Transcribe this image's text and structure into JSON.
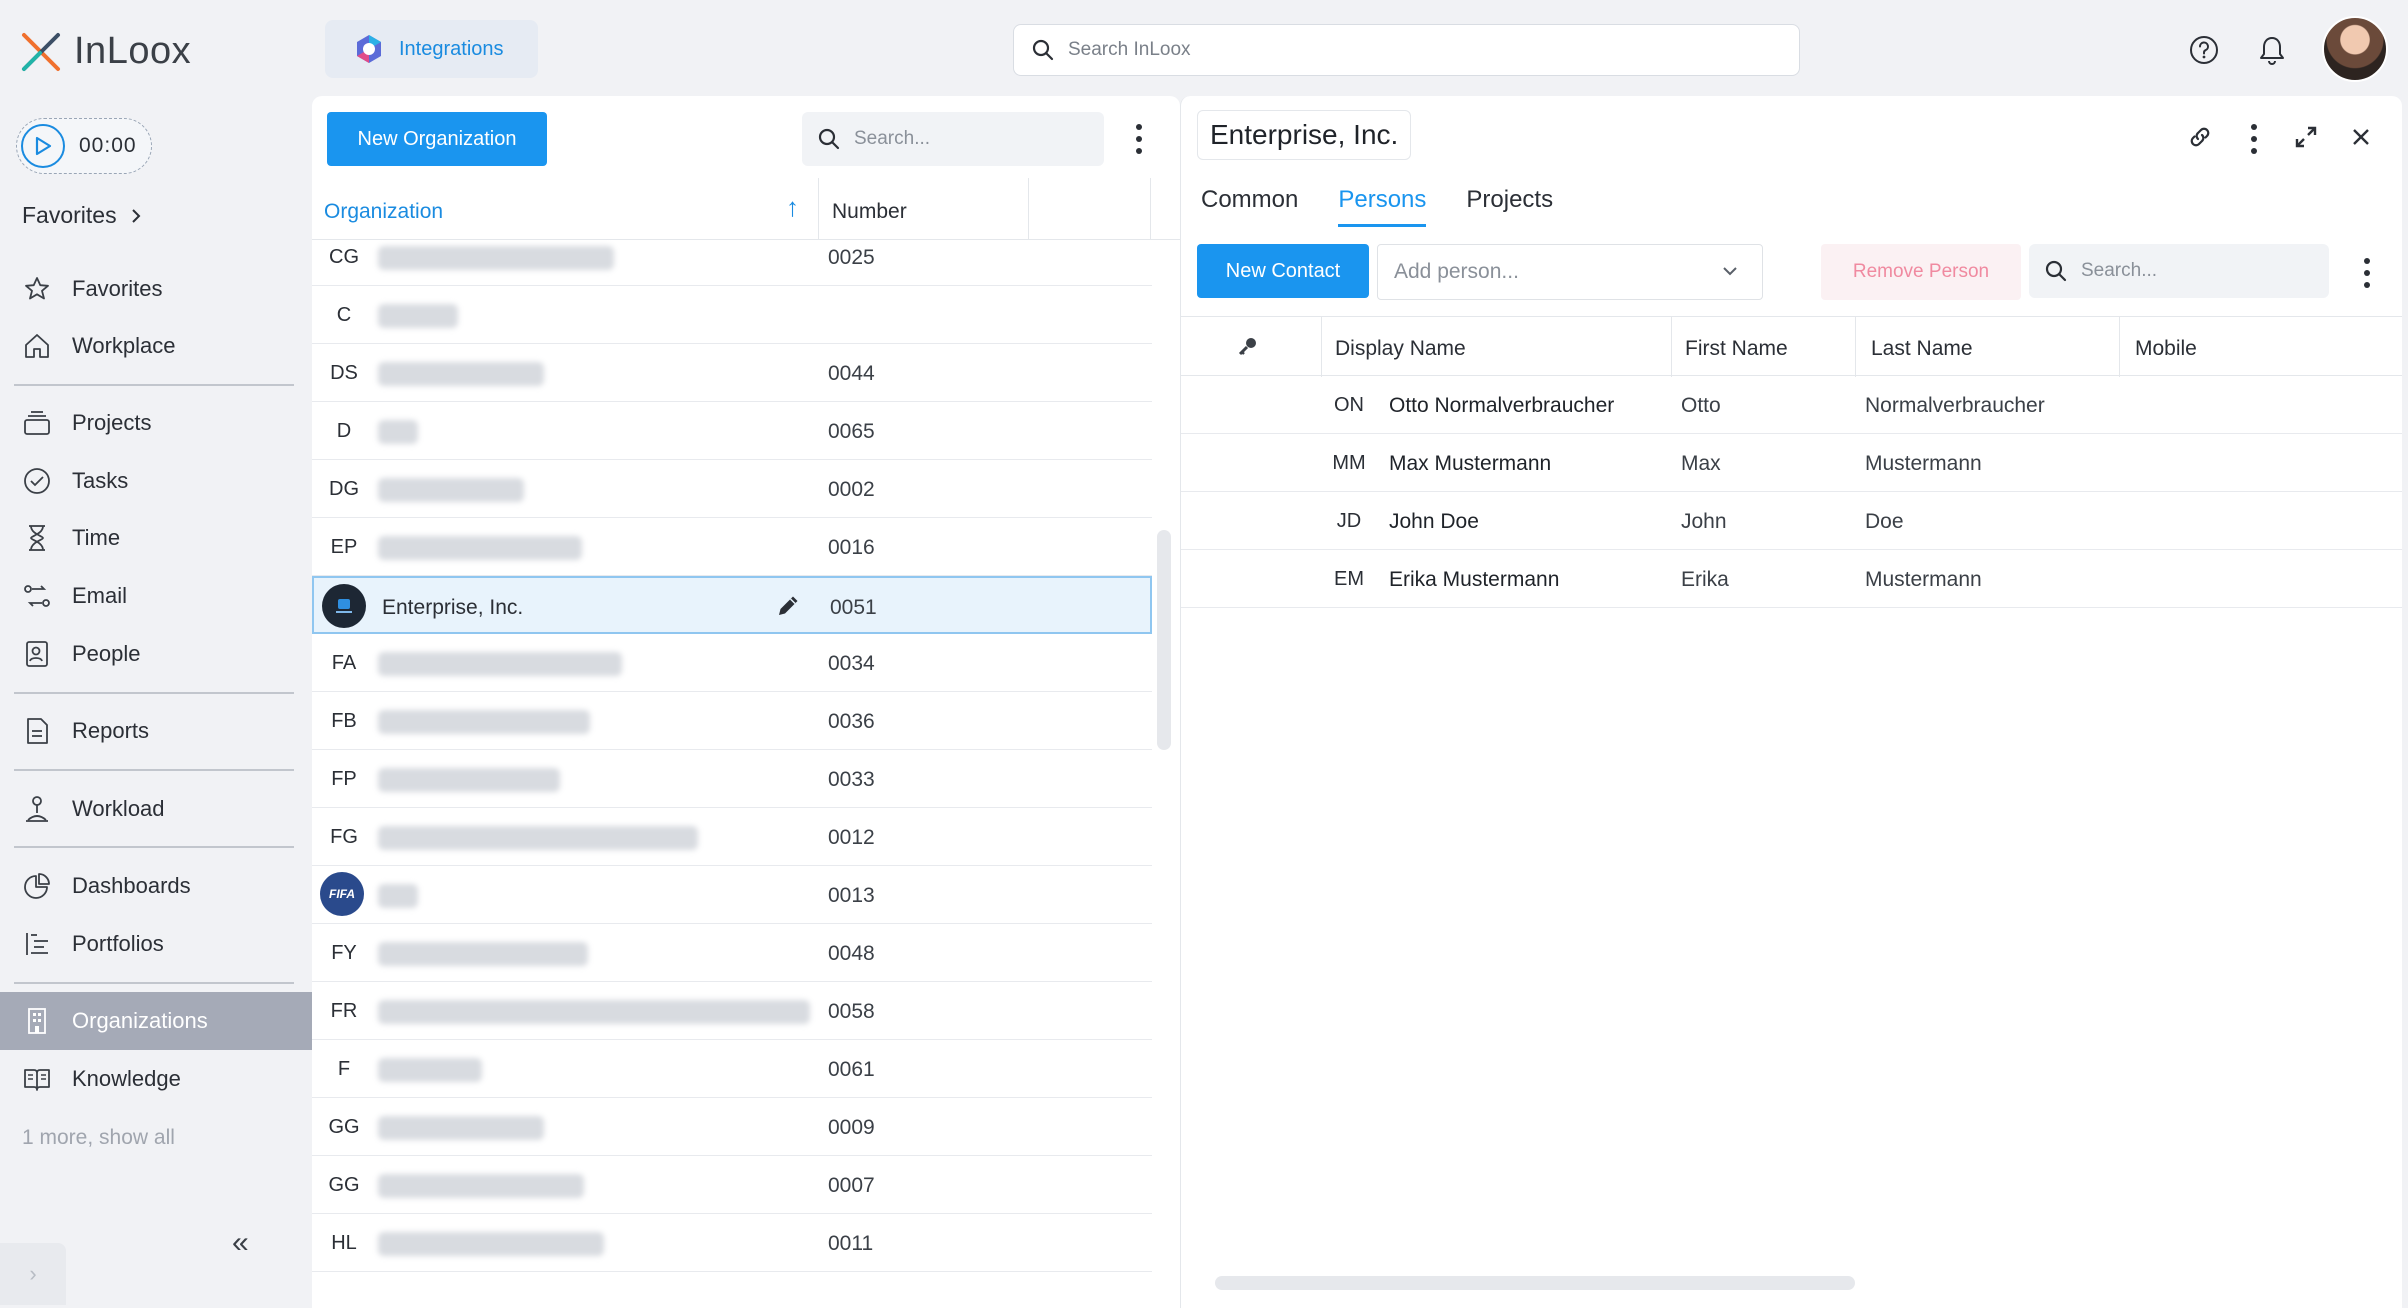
{
  "app": {
    "name": "InLoox"
  },
  "header": {
    "integrations_label": "Integrations",
    "search_placeholder": "Search InLoox"
  },
  "sidebar": {
    "timer": "00:00",
    "favorites_heading": "Favorites",
    "items": [
      {
        "label": "Favorites",
        "icon": "star-icon"
      },
      {
        "label": "Workplace",
        "icon": "home-icon"
      },
      {
        "label": "Projects",
        "icon": "projects-icon"
      },
      {
        "label": "Tasks",
        "icon": "check-circle-icon"
      },
      {
        "label": "Time",
        "icon": "hourglass-icon"
      },
      {
        "label": "Email",
        "icon": "email-flow-icon"
      },
      {
        "label": "People",
        "icon": "contacts-icon"
      },
      {
        "label": "Reports",
        "icon": "report-icon"
      },
      {
        "label": "Workload",
        "icon": "workload-icon"
      },
      {
        "label": "Dashboards",
        "icon": "pie-chart-icon"
      },
      {
        "label": "Portfolios",
        "icon": "portfolio-icon"
      },
      {
        "label": "Organizations",
        "icon": "building-icon"
      },
      {
        "label": "Knowledge",
        "icon": "book-icon"
      }
    ],
    "more_label": "1 more, show all"
  },
  "org_panel": {
    "new_button": "New Organization",
    "search_placeholder": "Search...",
    "columns": {
      "organization": "Organization",
      "number": "Number"
    },
    "rows": [
      {
        "abbr": "CG",
        "number": "0025"
      },
      {
        "abbr": "C",
        "number": ""
      },
      {
        "abbr": "DS",
        "number": "0044"
      },
      {
        "abbr": "D",
        "number": "0065"
      },
      {
        "abbr": "DG",
        "number": "0002"
      },
      {
        "abbr": "EP",
        "number": "0016"
      },
      {
        "abbr": "",
        "name": "Enterprise, Inc.",
        "number": "0051"
      },
      {
        "abbr": "FA",
        "number": "0034"
      },
      {
        "abbr": "FB",
        "number": "0036"
      },
      {
        "abbr": "FP",
        "number": "0033"
      },
      {
        "abbr": "FG",
        "number": "0012"
      },
      {
        "abbr": "FIFA",
        "number": "0013"
      },
      {
        "abbr": "FY",
        "number": "0048"
      },
      {
        "abbr": "FR",
        "number": "0058"
      },
      {
        "abbr": "F",
        "number": "0061"
      },
      {
        "abbr": "GG",
        "number": "0009"
      },
      {
        "abbr": "GG",
        "number": "0007"
      },
      {
        "abbr": "HL",
        "number": "0011"
      }
    ]
  },
  "detail": {
    "title": "Enterprise, Inc.",
    "tabs": [
      "Common",
      "Persons",
      "Projects"
    ],
    "active_tab": "Persons",
    "new_contact": "New Contact",
    "add_person_placeholder": "Add person...",
    "remove_person": "Remove Person",
    "search_placeholder": "Search...",
    "columns": {
      "display_name": "Display Name",
      "first_name": "First Name",
      "last_name": "Last Name",
      "mobile": "Mobile"
    },
    "persons": [
      {
        "initials": "ON",
        "display": "Otto Normalverbraucher",
        "first": "Otto",
        "last": "Normalverbraucher"
      },
      {
        "initials": "MM",
        "display": "Max Mustermann",
        "first": "Max",
        "last": "Mustermann"
      },
      {
        "initials": "JD",
        "display": "John Doe",
        "first": "John",
        "last": "Doe"
      },
      {
        "initials": "EM",
        "display": "Erika Mustermann",
        "first": "Erika",
        "last": "Mustermann"
      }
    ]
  },
  "colors": {
    "accent": "#1a95ef",
    "active_nav": "#a5aab7",
    "danger_soft": "#f08aa0"
  }
}
